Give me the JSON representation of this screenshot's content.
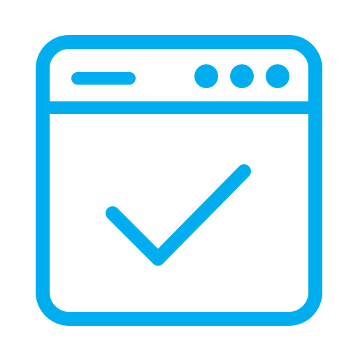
{
  "icon": {
    "name": "browser-window-checkmark-icon",
    "color": "#00AEEF",
    "background": "#FFFFFF",
    "window_dots": 3
  }
}
